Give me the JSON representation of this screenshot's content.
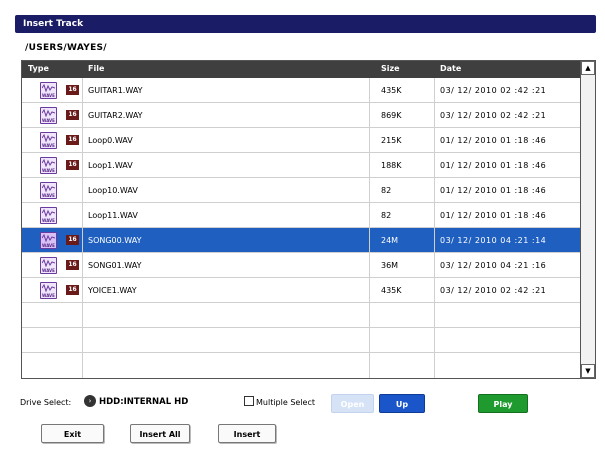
{
  "window": {
    "title": "Insert Track"
  },
  "path": "/USERS/WAYES/",
  "columns": {
    "type": "Type",
    "file": "File",
    "size": "Size",
    "date": "Date"
  },
  "icon_label": "WAVE",
  "files": [
    {
      "name": "GUITAR1.WAY",
      "size": "435K",
      "date": "03/ 12/ 2010   02 :42 :21",
      "bit": "16",
      "selected": false
    },
    {
      "name": "GUITAR2.WAY",
      "size": "869K",
      "date": "03/ 12/ 2010   02 :42 :21",
      "bit": "16",
      "selected": false
    },
    {
      "name": "Loop0.WAV",
      "size": "215K",
      "date": "01/ 12/ 2010   01 :18 :46",
      "bit": "16",
      "selected": false
    },
    {
      "name": "Loop1.WAV",
      "size": "188K",
      "date": "01/ 12/ 2010   01 :18 :46",
      "bit": "16",
      "selected": false
    },
    {
      "name": "Loop10.WAV",
      "size": "82",
      "date": "01/ 12/ 2010   01 :18 :46",
      "bit": "",
      "selected": false
    },
    {
      "name": "Loop11.WAV",
      "size": "82",
      "date": "01/ 12/ 2010   01 :18 :46",
      "bit": "",
      "selected": false
    },
    {
      "name": "SONG00.WAY",
      "size": "24M",
      "date": "03/ 12/ 2010   04 :21 :14",
      "bit": "16",
      "selected": true
    },
    {
      "name": "SONG01.WAY",
      "size": "36M",
      "date": "03/ 12/ 2010   04 :21 :16",
      "bit": "16",
      "selected": false
    },
    {
      "name": "YOICE1.WAY",
      "size": "435K",
      "date": "03/ 12/ 2010   02 :42 :21",
      "bit": "16",
      "selected": false
    }
  ],
  "drive": {
    "label": "Drive Select:",
    "value": "HDD:INTERNAL HD"
  },
  "multiple_select": {
    "label": "Multiple Select",
    "checked": false
  },
  "buttons": {
    "open": "Open",
    "up": "Up",
    "play": "Play",
    "exit": "Exit",
    "insert_all": "Insert All",
    "insert": "Insert"
  },
  "colors": {
    "title_bg": "#1a1d66",
    "header_bg": "#3f3f3f",
    "selected_row": "#1f5fbf",
    "up_button": "#1a56c9",
    "play_button": "#1f9a2f",
    "bit_badge": "#6b1a1a"
  }
}
